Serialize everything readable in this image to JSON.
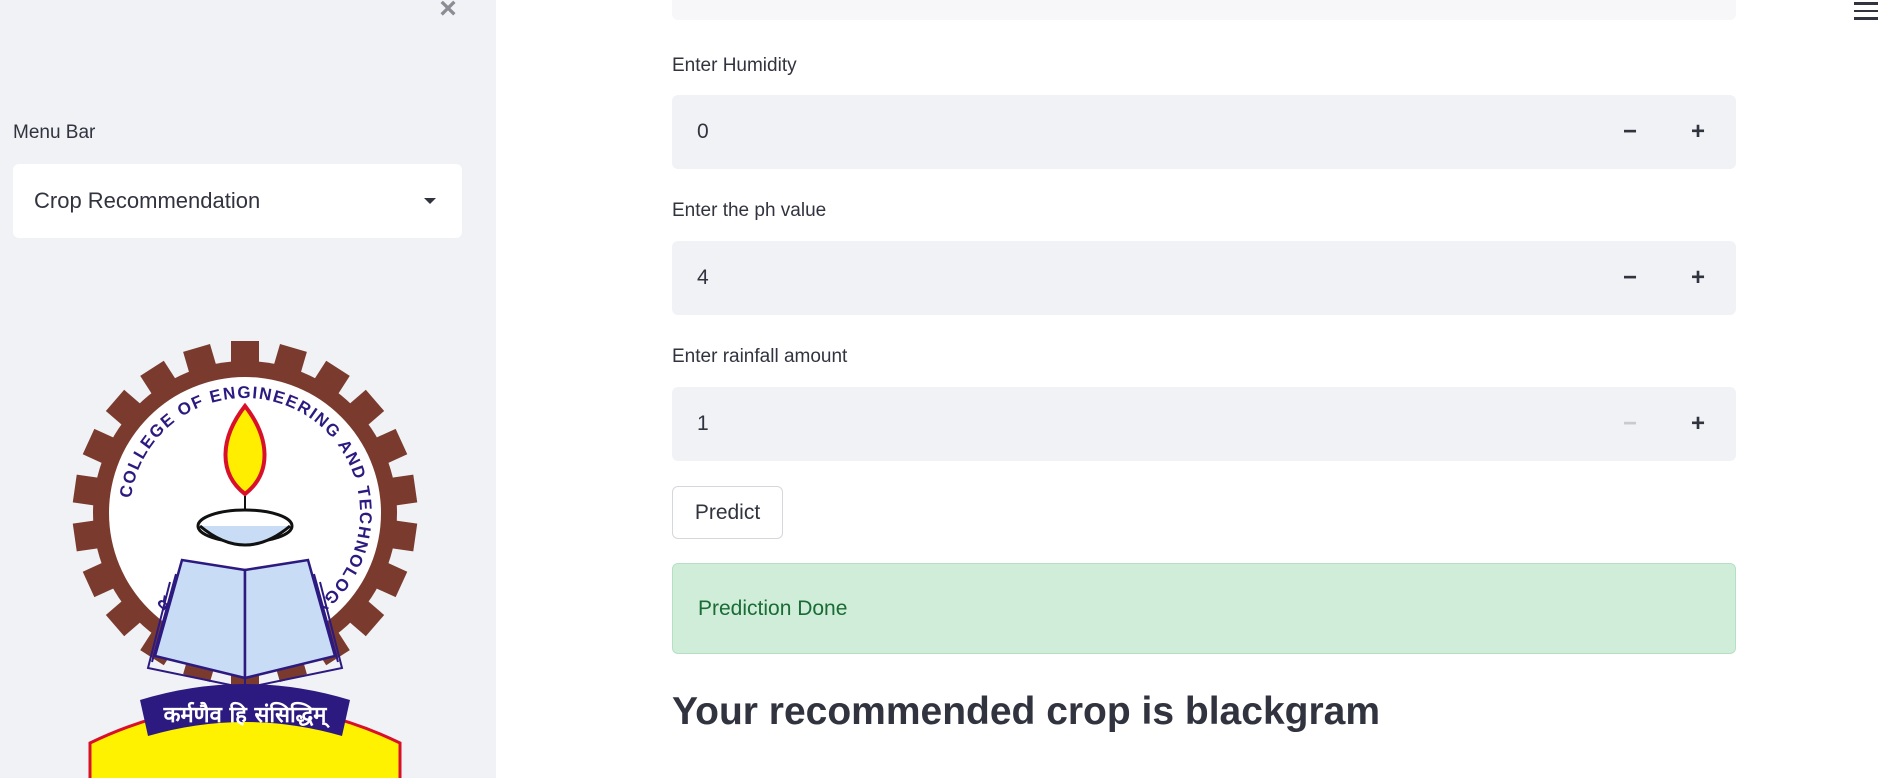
{
  "sidebar": {
    "close_icon": "×",
    "menu_label": "Menu Bar",
    "menu_selected": "Crop Recommendation",
    "logo": {
      "ring_text": "COLLEGE OF ENGINEERING AND TECHNOLOGY, BHUBANESWAR",
      "motto": "कर्मणैव हि संसिद्धिम्",
      "colors": {
        "gear": "#7a3b2e",
        "ring_text": "#2d1a80",
        "flame": "#ffee00",
        "flame_outline": "#d9102a",
        "book": "#c8dcf5",
        "banner": "#2d1a80",
        "ribbon": "#fff200"
      }
    }
  },
  "header": {
    "menu_icon": "hamburger-icon"
  },
  "form": {
    "humidity": {
      "label": "Enter Humidity",
      "value": "0"
    },
    "ph": {
      "label": "Enter the ph value",
      "value": "4"
    },
    "rainfall": {
      "label": "Enter rainfall amount",
      "value": "1"
    },
    "minus_symbol": "−",
    "plus_symbol": "+",
    "predict_label": "Predict"
  },
  "result": {
    "status_text": "Prediction Done",
    "heading": "Your recommended crop is blackgram"
  },
  "colors": {
    "sidebar_bg": "#f0f2f6",
    "input_bg": "#f0f2f6",
    "success_bg": "#d0edd9",
    "success_text": "#1a6b35",
    "text": "#31333f"
  }
}
